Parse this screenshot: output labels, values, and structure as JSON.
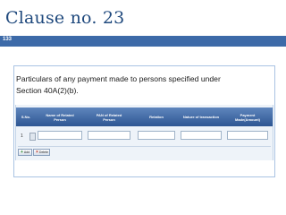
{
  "slide": {
    "title": "Clause no. 23",
    "number": "133"
  },
  "description": {
    "line1": "Particulars of any payment made to persons specified under",
    "line2": "Section 40A(2)(b)."
  },
  "table": {
    "headers": {
      "sno": "S.No.",
      "name": [
        "Name of Related",
        "Person"
      ],
      "pan": [
        "PAN of Related",
        "Person"
      ],
      "relation": "Relation",
      "nature": "Nature of transaction",
      "payment": [
        "Payment",
        "Made(Amount)"
      ]
    },
    "rows": [
      {
        "sno": "1",
        "name": "",
        "pan": "",
        "relation": "",
        "nature": "",
        "payment": ""
      }
    ],
    "buttons": {
      "add_label": "Add",
      "delete_label": "Delete"
    }
  },
  "colors": {
    "title": "#1f497d",
    "title_rule": "#3d6aa8",
    "table_header": "#3d6aa8"
  }
}
